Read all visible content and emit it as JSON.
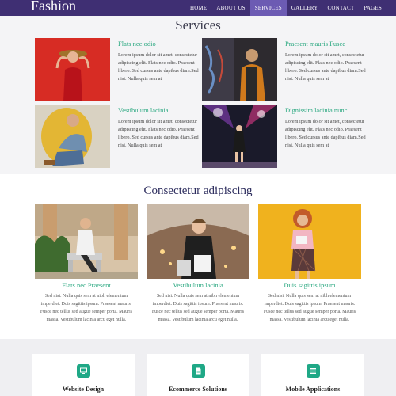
{
  "header": {
    "brand": "Fashion",
    "nav": [
      "HOME",
      "ABOUT US",
      "SERVICES",
      "GALLERY",
      "CONTACT",
      "PAGES"
    ],
    "active": "SERVICES"
  },
  "services": {
    "title": "Services",
    "items": [
      {
        "title": "Flats nec odio",
        "text": "Lorem ipsum dolor sit amet, consectetur adipiscing elit. Flats nec odio. Praesent libero. Sed cursus ante dapibus diam.Sed nisi. Nulla quis sem at"
      },
      {
        "title": "Praesent mauris Fusce",
        "text": "Lorem ipsum dolor sit amet, consectetur adipiscing elit. Flats nec odio. Praesent libero. Sed cursus ante dapibus diam.Sed nisi. Nulla quis sem at"
      },
      {
        "title": "Vestibulum lacinia",
        "text": "Lorem ipsum dolor sit amet, consectetur adipiscing elit. Flats nec odio. Praesent libero. Sed cursus ante dapibus diam.Sed nisi. Nulla quis sem at"
      },
      {
        "title": "Dignissim lacinia nunc",
        "text": "Lorem ipsum dolor sit amet, consectetur adipiscing elit. Flats nec odio. Praesent libero. Sed cursus ante dapibus diam.Sed nisi. Nulla quis sem at"
      }
    ]
  },
  "featured": {
    "title": "Consectetur adipiscing",
    "cards": [
      {
        "title": "Flats nec Praesent",
        "text": "Sed nisi. Nulla quis sem at nibh elementum imperdiet. Duis sagittis ipsum. Praesent mauris. Fusce nec tellus sed augue semper porta. Mauris massa. Vestibulum lacinia arcu eget nulla."
      },
      {
        "title": "Vestibulum lacinia",
        "text": "Sed nisi. Nulla quis sem at nibh elementum imperdiet. Duis sagittis ipsum. Praesent mauris. Fusce nec tellus sed augue semper porta. Mauris massa. Vestibulum lacinia arcu eget nulla."
      },
      {
        "title": "Duis sagittis ipsum",
        "text": "Sed nisi. Nulla quis sem at nibh elementum imperdiet. Duis sagittis ipsum. Praesent mauris. Fusce nec tellus sed augue semper porta. Mauris massa. Vestibulum lacinia arcu eget nulla."
      }
    ]
  },
  "features": [
    {
      "label": "Website Design",
      "icon": "monitor-icon"
    },
    {
      "label": "Ecommerce Solutions",
      "icon": "document-icon"
    },
    {
      "label": "Mobile Applications",
      "icon": "list-icon"
    }
  ],
  "colors": {
    "header": "#3f2f73",
    "active_nav": "#6c5bb3",
    "accent": "#2aa880",
    "icon_bg": "#1fa886"
  }
}
